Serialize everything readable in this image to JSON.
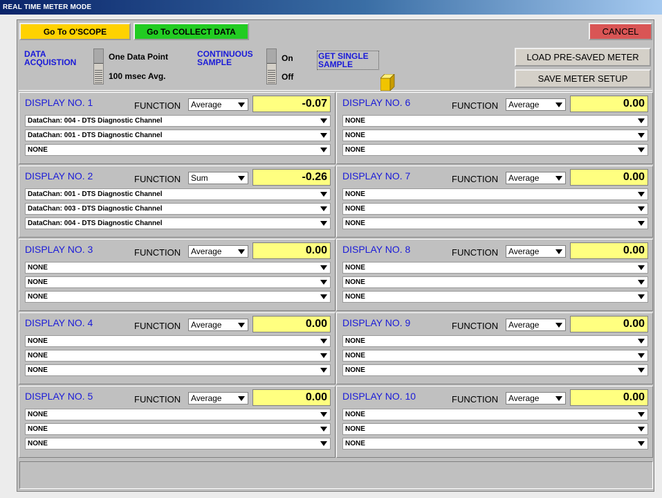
{
  "window": {
    "title": "REAL TIME METER MODE"
  },
  "toolbar": {
    "oscope_label": "Go To O'SCOPE",
    "collect_label": "Go To COLLECT DATA",
    "cancel_label": "CANCEL"
  },
  "acquisition": {
    "data_label_1": "DATA",
    "data_label_2": "ACQUISTION",
    "one_point": "One Data Point",
    "avg": "100 msec Avg.",
    "cont_label_1": "CONTINUOUS",
    "cont_label_2": "SAMPLE",
    "on": "On",
    "off": "Off",
    "single_1": "GET SINGLE",
    "single_2": "SAMPLE",
    "load_label": "LOAD PRE-SAVED METER",
    "save_label": "SAVE METER SETUP"
  },
  "function_label": "FUNCTION",
  "displays": [
    {
      "title": "DISPLAY NO. 1",
      "function": "Average",
      "value": "-0.07",
      "channels": [
        "DataChan: 004 - DTS Diagnostic Channel",
        "DataChan: 001 - DTS Diagnostic Channel",
        "NONE"
      ]
    },
    {
      "title": "DISPLAY NO. 2",
      "function": "Sum",
      "value": "-0.26",
      "channels": [
        "DataChan: 001 - DTS Diagnostic Channel",
        "DataChan: 003 - DTS Diagnostic Channel",
        "DataChan: 004 - DTS Diagnostic Channel"
      ]
    },
    {
      "title": "DISPLAY NO. 3",
      "function": "Average",
      "value": "0.00",
      "channels": [
        "NONE",
        "NONE",
        "NONE"
      ]
    },
    {
      "title": "DISPLAY NO. 4",
      "function": "Average",
      "value": "0.00",
      "channels": [
        "NONE",
        "NONE",
        "NONE"
      ]
    },
    {
      "title": "DISPLAY NO. 5",
      "function": "Average",
      "value": "0.00",
      "channels": [
        "NONE",
        "NONE",
        "NONE"
      ]
    },
    {
      "title": "DISPLAY NO. 6",
      "function": "Average",
      "value": "0.00",
      "channels": [
        "NONE",
        "NONE",
        "NONE"
      ]
    },
    {
      "title": "DISPLAY NO. 7",
      "function": "Average",
      "value": "0.00",
      "channels": [
        "NONE",
        "NONE",
        "NONE"
      ]
    },
    {
      "title": "DISPLAY NO. 8",
      "function": "Average",
      "value": "0.00",
      "channels": [
        "NONE",
        "NONE",
        "NONE"
      ]
    },
    {
      "title": "DISPLAY NO. 9",
      "function": "Average",
      "value": "0.00",
      "channels": [
        "NONE",
        "NONE",
        "NONE"
      ]
    },
    {
      "title": "DISPLAY NO. 10",
      "function": "Average",
      "value": "0.00",
      "channels": [
        "NONE",
        "NONE",
        "NONE"
      ]
    }
  ]
}
